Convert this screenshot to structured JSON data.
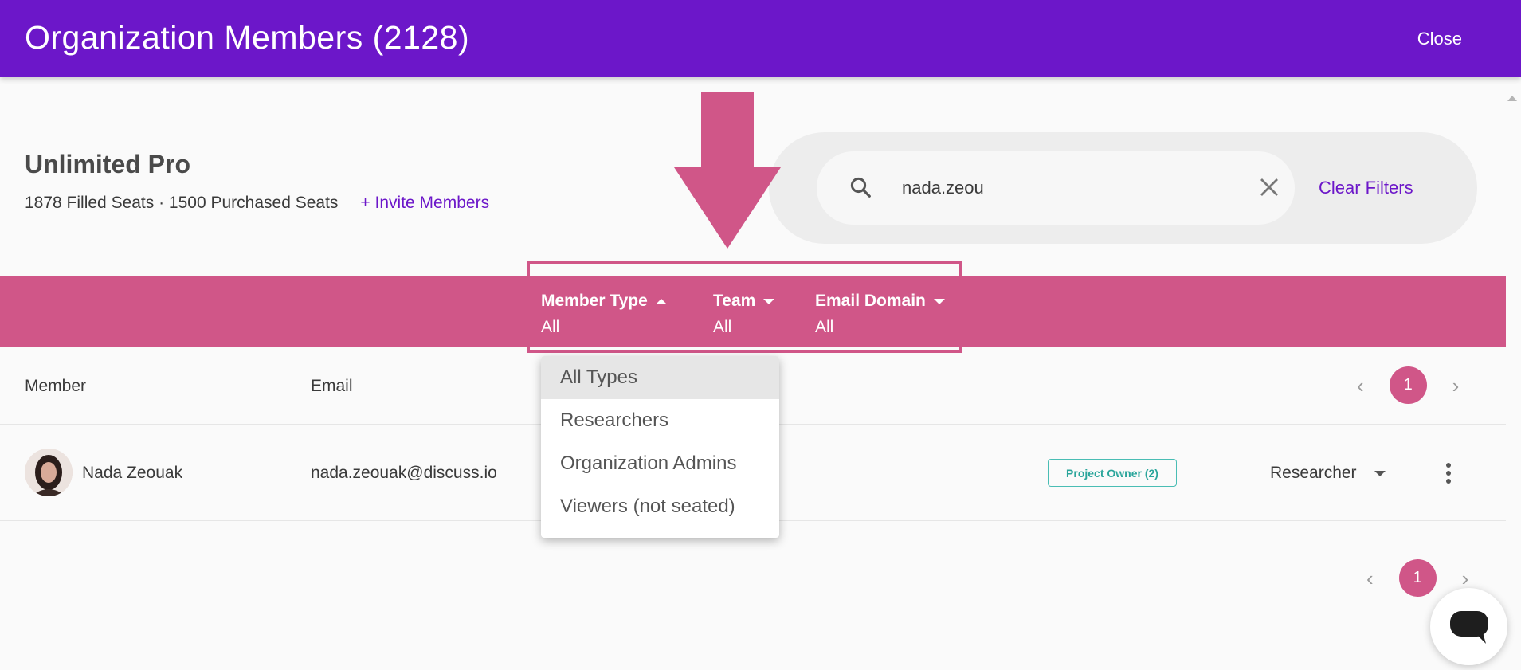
{
  "header": {
    "title": "Organization Members (2128)",
    "close_label": "Close"
  },
  "plan": {
    "name": "Unlimited Pro",
    "seats_text": "1878 Filled Seats · 1500 Purchased Seats",
    "invite_label": "+ Invite Members"
  },
  "search": {
    "value": "nada.zeou",
    "clear_filters_label": "Clear Filters"
  },
  "filters": [
    {
      "label": "Member Type",
      "value": "All",
      "state": "open"
    },
    {
      "label": "Team",
      "value": "All",
      "state": "closed"
    },
    {
      "label": "Email Domain",
      "value": "All",
      "state": "closed"
    }
  ],
  "dropdown": {
    "options": [
      "All Types",
      "Researchers",
      "Organization Admins",
      "Viewers (not seated)"
    ],
    "selected": "All Types"
  },
  "table": {
    "columns": [
      "Member",
      "Email"
    ],
    "rows": [
      {
        "name": "Nada Zeouak",
        "email": "nada.zeouak@discuss.io",
        "badge": "Project Owner (2)",
        "role": "Researcher"
      }
    ]
  },
  "pagination": {
    "current_page": "1",
    "prev_icon": "chevron-left-icon",
    "next_icon": "chevron-right-icon"
  },
  "colors": {
    "header": "#6c17c9",
    "filter_bar": "#d05688",
    "accent_link": "#6c17c9",
    "badge": "#2aa59b"
  },
  "icons": {
    "search": "search-icon",
    "clear": "close-icon",
    "arrow": "arrow-down-icon",
    "chat": "chat-icon",
    "more": "more-vertical-icon"
  }
}
